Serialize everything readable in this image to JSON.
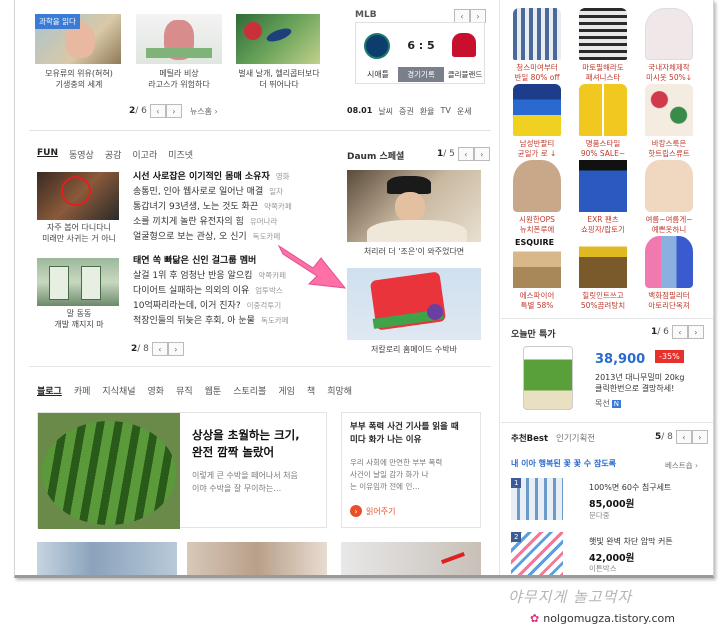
{
  "top_news": {
    "badge": "과학을 읽다",
    "items": [
      {
        "caption": "모유류의 위유(혀혀)\n기생충의 세계"
      },
      {
        "caption": "메틸라 비상\n라고스가 위험하다"
      },
      {
        "caption": "벌새 날개, 헬리콥터보다\n더 뛰어나다"
      }
    ],
    "pager": {
      "current": "2",
      "total": "/ 6",
      "more": "뉴스홈 ›"
    }
  },
  "mlb": {
    "title": "MLB",
    "score": "6 : 5",
    "team_left": "시애틀",
    "status": "경기기록",
    "team_right": "클리블랜드",
    "date": "08.01",
    "links": [
      "날씨",
      "증권",
      "환율",
      "TV",
      "운세"
    ]
  },
  "fun": {
    "tabs": [
      "FUN",
      "동영상",
      "공감",
      "이고라",
      "미즈넷"
    ],
    "thumb1_caption": "자주 봅어 다니다니\n미래만 사귀는 거 아니",
    "thumb2_caption": "말 동동\n개발 깨지지 마",
    "lines": [
      {
        "text": "시선 사로잡은 이기적인 몸매 소유자",
        "src": "영화",
        "bold": true
      },
      {
        "text": "송통민, 인아 웹사로로 일어난 매결",
        "src": "일자"
      },
      {
        "text": "통갑녀기 93년생, 노는 것도 화끈",
        "src": "약쪽카페"
      },
      {
        "text": "소를 끼치게 놀란 유전자의 힘",
        "src": "유머나라"
      },
      {
        "text": "얼굴형으로 보는 관상, 오 신기",
        "src": "독도카페"
      },
      {
        "text": "태연 쏙 빠닮은 신인 걸그룹 멤버",
        "src": "",
        "bold": true
      },
      {
        "text": "살걸 1위 후 엄청난 반응 알으킴",
        "src": "약쪽카페"
      },
      {
        "text": "다이어트 실패하는 의외의 이유",
        "src": "엄투박스"
      },
      {
        "text": "10억짜리라는데, 이거 진자?",
        "src": "이중걱투기"
      },
      {
        "text": "적장인들의 뒤늦은 후회, 아 눈물",
        "src": "독도카페"
      }
    ],
    "pager": {
      "current": "2",
      "total": "/ 8"
    }
  },
  "daum_special": {
    "title": "Daum 스페셜",
    "pager": {
      "current": "1",
      "total": "/ 5"
    },
    "cap1": "처리러 더 '조은'이 와주었다면",
    "cap2": "저칼로리 홈메이드 수박바"
  },
  "blog": {
    "tabs": [
      "블로그",
      "카페",
      "지식채널",
      "영화",
      "뮤직",
      "웹툰",
      "스토리볼",
      "게임",
      "책",
      "희망해"
    ],
    "main_title": "상상을 초월하는 크기,\n완전 깜짝 놀랐어",
    "main_desc": "이렇게 큰 수박을 떼어나서 처음\n이야 수박을 잘 무이하는…",
    "side_title": "부부 폭력 사건 기사를 읽을 때\n미다 화가 나는 이유",
    "side_desc": "우리 사회에 만연한 부부 폭력\n사건이 날일 감가 화가 나\n는 이유임까 전에 인…",
    "side_more": "읽어주기"
  },
  "shopping": {
    "products": [
      {
        "label": "청스미여부터\n반일 80% off"
      },
      {
        "label": "마토필해라도\n패셔니스타"
      },
      {
        "label": "국내자체제작\n미시옷 50%↓"
      },
      {
        "label": "남성반팔티\n균일가 로 ↓"
      },
      {
        "label": "명품스타일\n90% SALE~"
      },
      {
        "label": "바캉스룩은\n핫트립스류트"
      },
      {
        "label": "시원한OPS\n뉴치폰루에"
      },
      {
        "label": "EXR 팬츠\n쇼핑자/랍토기"
      },
      {
        "label": "여름~여름게~\n예쁜옷하니"
      },
      {
        "label": "에스파이어\n특별 58%"
      },
      {
        "label": "힐릿인트쓰고\n50%끔려탕치"
      },
      {
        "label": "백화점필리터\n아토리단옥져"
      }
    ]
  },
  "today_special": {
    "title": "오늘만 특가",
    "pager": {
      "current": "1",
      "total": "/ 6"
    },
    "price": "38,900",
    "discount": "-35%",
    "desc": "2013년 대니무밀미 20kg\n클릭한번으로 결망하세!",
    "seller": "목선",
    "seller_badge": "N"
  },
  "recommend": {
    "tabs": [
      "추천Best",
      "인기기획전"
    ],
    "pager": {
      "current": "5",
      "total": "/ 8"
    },
    "headline": "내 이아 행복된 꽃 꽃 수 잠도록",
    "more": "베스트숍 ›",
    "items": [
      {
        "rank": "1",
        "name": "100%면 60수 침구세트",
        "price": "85,000원",
        "seller": "문다중"
      },
      {
        "rank": "2",
        "name": "햇빛 완벽 차단 암막 커튼",
        "price": "42,000원",
        "seller": "이튼박스"
      }
    ]
  },
  "watermark": {
    "script": "야무지게 놀고먹자",
    "url": "nolgomugza.tistory.com"
  }
}
